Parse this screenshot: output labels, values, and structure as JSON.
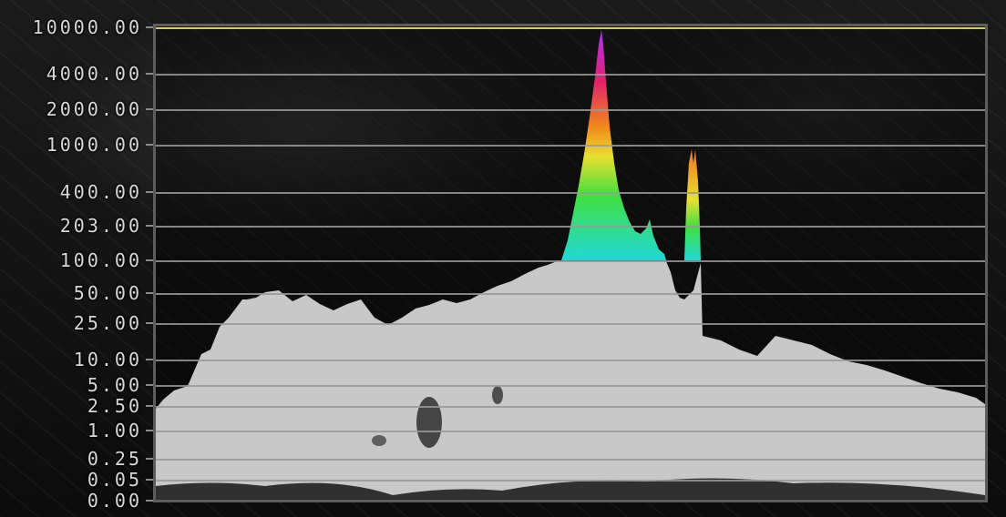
{
  "scope": {
    "scale_labels": [
      "10000.00",
      "4000.00",
      "2000.00",
      "1000.00",
      "400.00",
      "203.00",
      "100.00",
      "50.00",
      "25.00",
      "10.00",
      "5.00",
      "2.50",
      "1.00",
      "0.25",
      "0.05",
      "0.00"
    ],
    "colors": {
      "histogram_fill": "#c8c8c8",
      "gridline": "#9a9a9a",
      "peak_line": "#d6d24a",
      "frame": "#5d5d5d",
      "label": "#d8d8d8"
    }
  }
}
